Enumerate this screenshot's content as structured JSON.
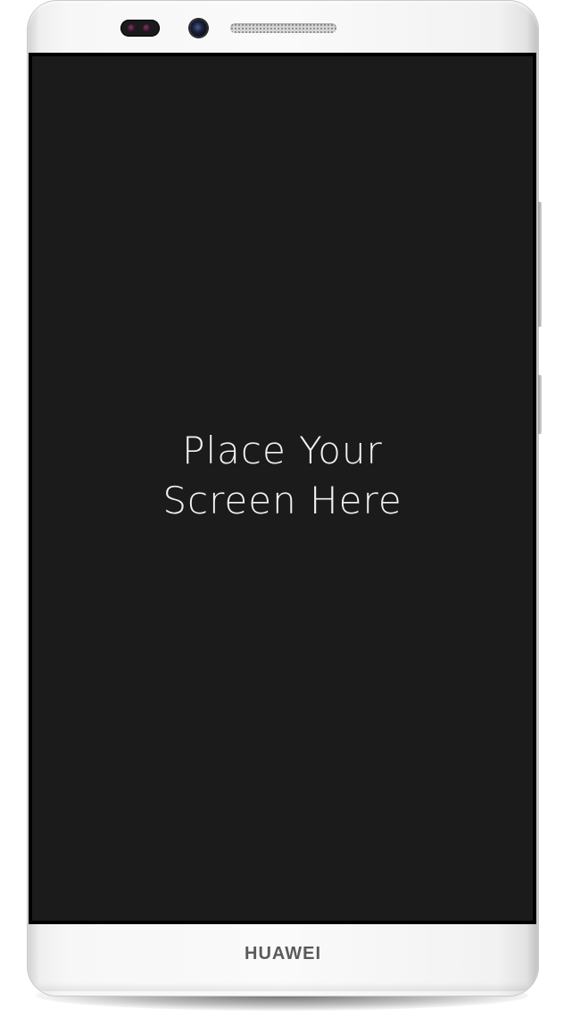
{
  "screen": {
    "placeholder_line_1": "Place Your",
    "placeholder_line_2": "Screen Here"
  },
  "device": {
    "brand_label": "HUAWEI"
  }
}
